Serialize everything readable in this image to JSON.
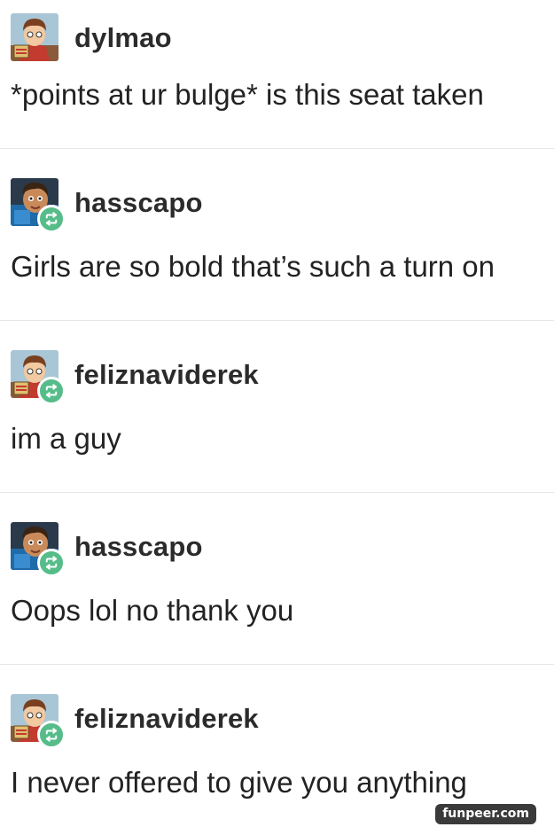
{
  "thread": {
    "posts": [
      {
        "username": "dylmao",
        "text": "*points at ur bulge* is this seat taken",
        "avatar_icon": "cartoon-boy-avatar",
        "reblogged": false
      },
      {
        "username": "hasscapo",
        "text": "Girls are so bold that’s such a turn on",
        "avatar_icon": "animated-character-avatar",
        "reblogged": true
      },
      {
        "username": "feliznaviderek",
        "text": "im a guy",
        "avatar_icon": "cartoon-boy-avatar",
        "reblogged": true
      },
      {
        "username": "hasscapo",
        "text": "Oops lol no thank you",
        "avatar_icon": "animated-character-avatar",
        "reblogged": true
      },
      {
        "username": "feliznaviderek",
        "text": "I never offered to give you anything",
        "avatar_icon": "cartoon-boy-avatar",
        "reblogged": true
      }
    ]
  },
  "reblog_icon": "reblog-icon",
  "colors": {
    "reblog_badge": "#56bc8a",
    "divider": "#e6e6e6",
    "text": "#222222",
    "watermark_bg": "#3a3a3a"
  },
  "watermark": {
    "text": "funpeer.com"
  }
}
